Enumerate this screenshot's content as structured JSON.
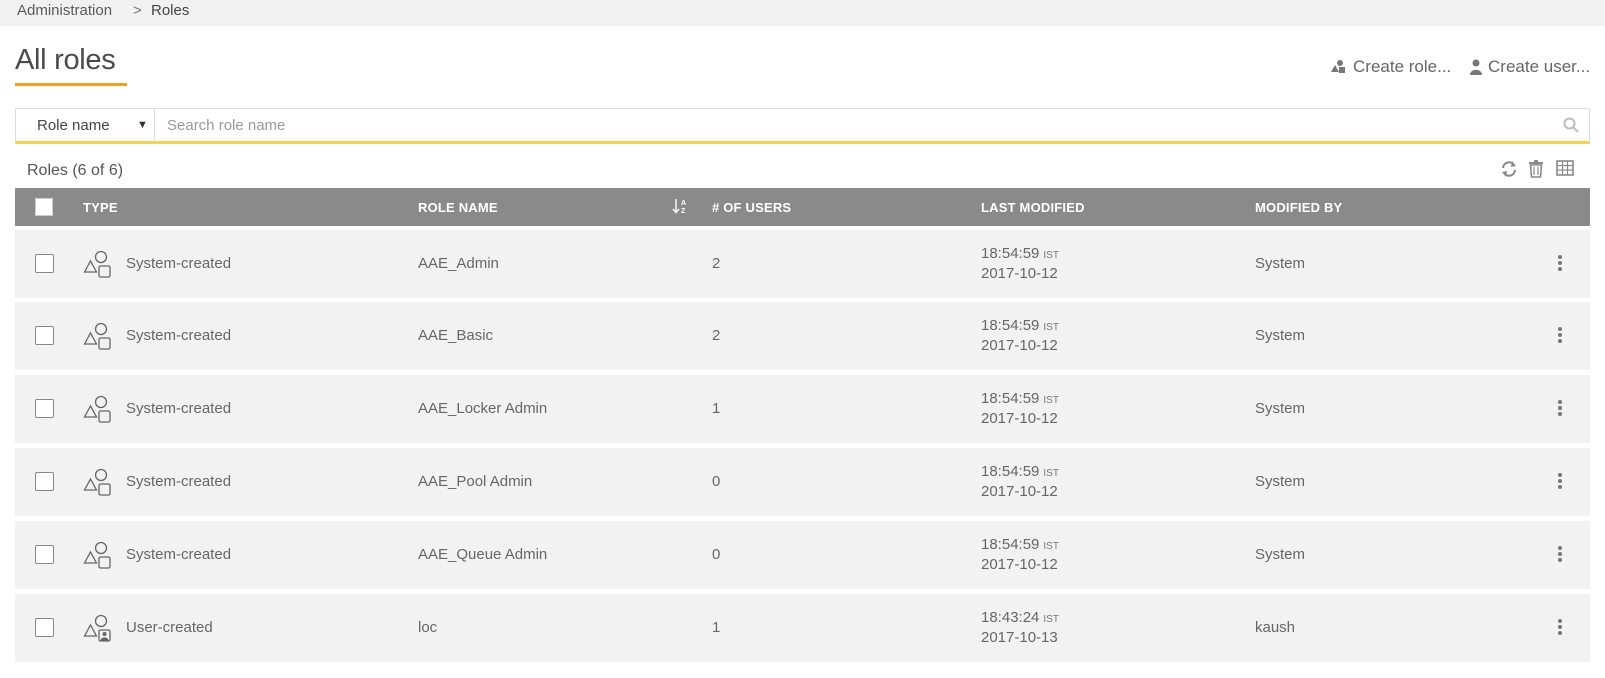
{
  "breadcrumb": {
    "parent": "Administration",
    "separator": ">",
    "current": "Roles"
  },
  "page": {
    "title": "All roles"
  },
  "actions": {
    "create_role": "Create role...",
    "create_user": "Create user..."
  },
  "search": {
    "field_selected": "Role name",
    "placeholder": "Search role name"
  },
  "table": {
    "count_label": "Roles (6 of 6)",
    "headers": {
      "type": "TYPE",
      "role_name": "ROLE NAME",
      "users": "# OF USERS",
      "last_modified": "LAST MODIFIED",
      "modified_by": "MODIFIED BY"
    },
    "rows": [
      {
        "type": "System-created",
        "role": "AAE_Admin",
        "users": "2",
        "time": "18:54:59",
        "tz": "IST",
        "date": "2017-10-12",
        "by": "System",
        "icon": "system-role-icon"
      },
      {
        "type": "System-created",
        "role": "AAE_Basic",
        "users": "2",
        "time": "18:54:59",
        "tz": "IST",
        "date": "2017-10-12",
        "by": "System",
        "icon": "system-role-icon"
      },
      {
        "type": "System-created",
        "role": "AAE_Locker Admin",
        "users": "1",
        "time": "18:54:59",
        "tz": "IST",
        "date": "2017-10-12",
        "by": "System",
        "icon": "system-role-icon"
      },
      {
        "type": "System-created",
        "role": "AAE_Pool Admin",
        "users": "0",
        "time": "18:54:59",
        "tz": "IST",
        "date": "2017-10-12",
        "by": "System",
        "icon": "system-role-icon"
      },
      {
        "type": "System-created",
        "role": "AAE_Queue Admin",
        "users": "0",
        "time": "18:54:59",
        "tz": "IST",
        "date": "2017-10-12",
        "by": "System",
        "icon": "system-role-icon"
      },
      {
        "type": "User-created",
        "role": "loc",
        "users": "1",
        "time": "18:43:24",
        "tz": "IST",
        "date": "2017-10-13",
        "by": "kaush",
        "icon": "user-role-icon"
      }
    ]
  },
  "colors": {
    "accent": "#f0a020",
    "search_underline": "#f7d34a",
    "header_bg": "#8a8a8a",
    "row_bg": "#f2f2f2"
  }
}
